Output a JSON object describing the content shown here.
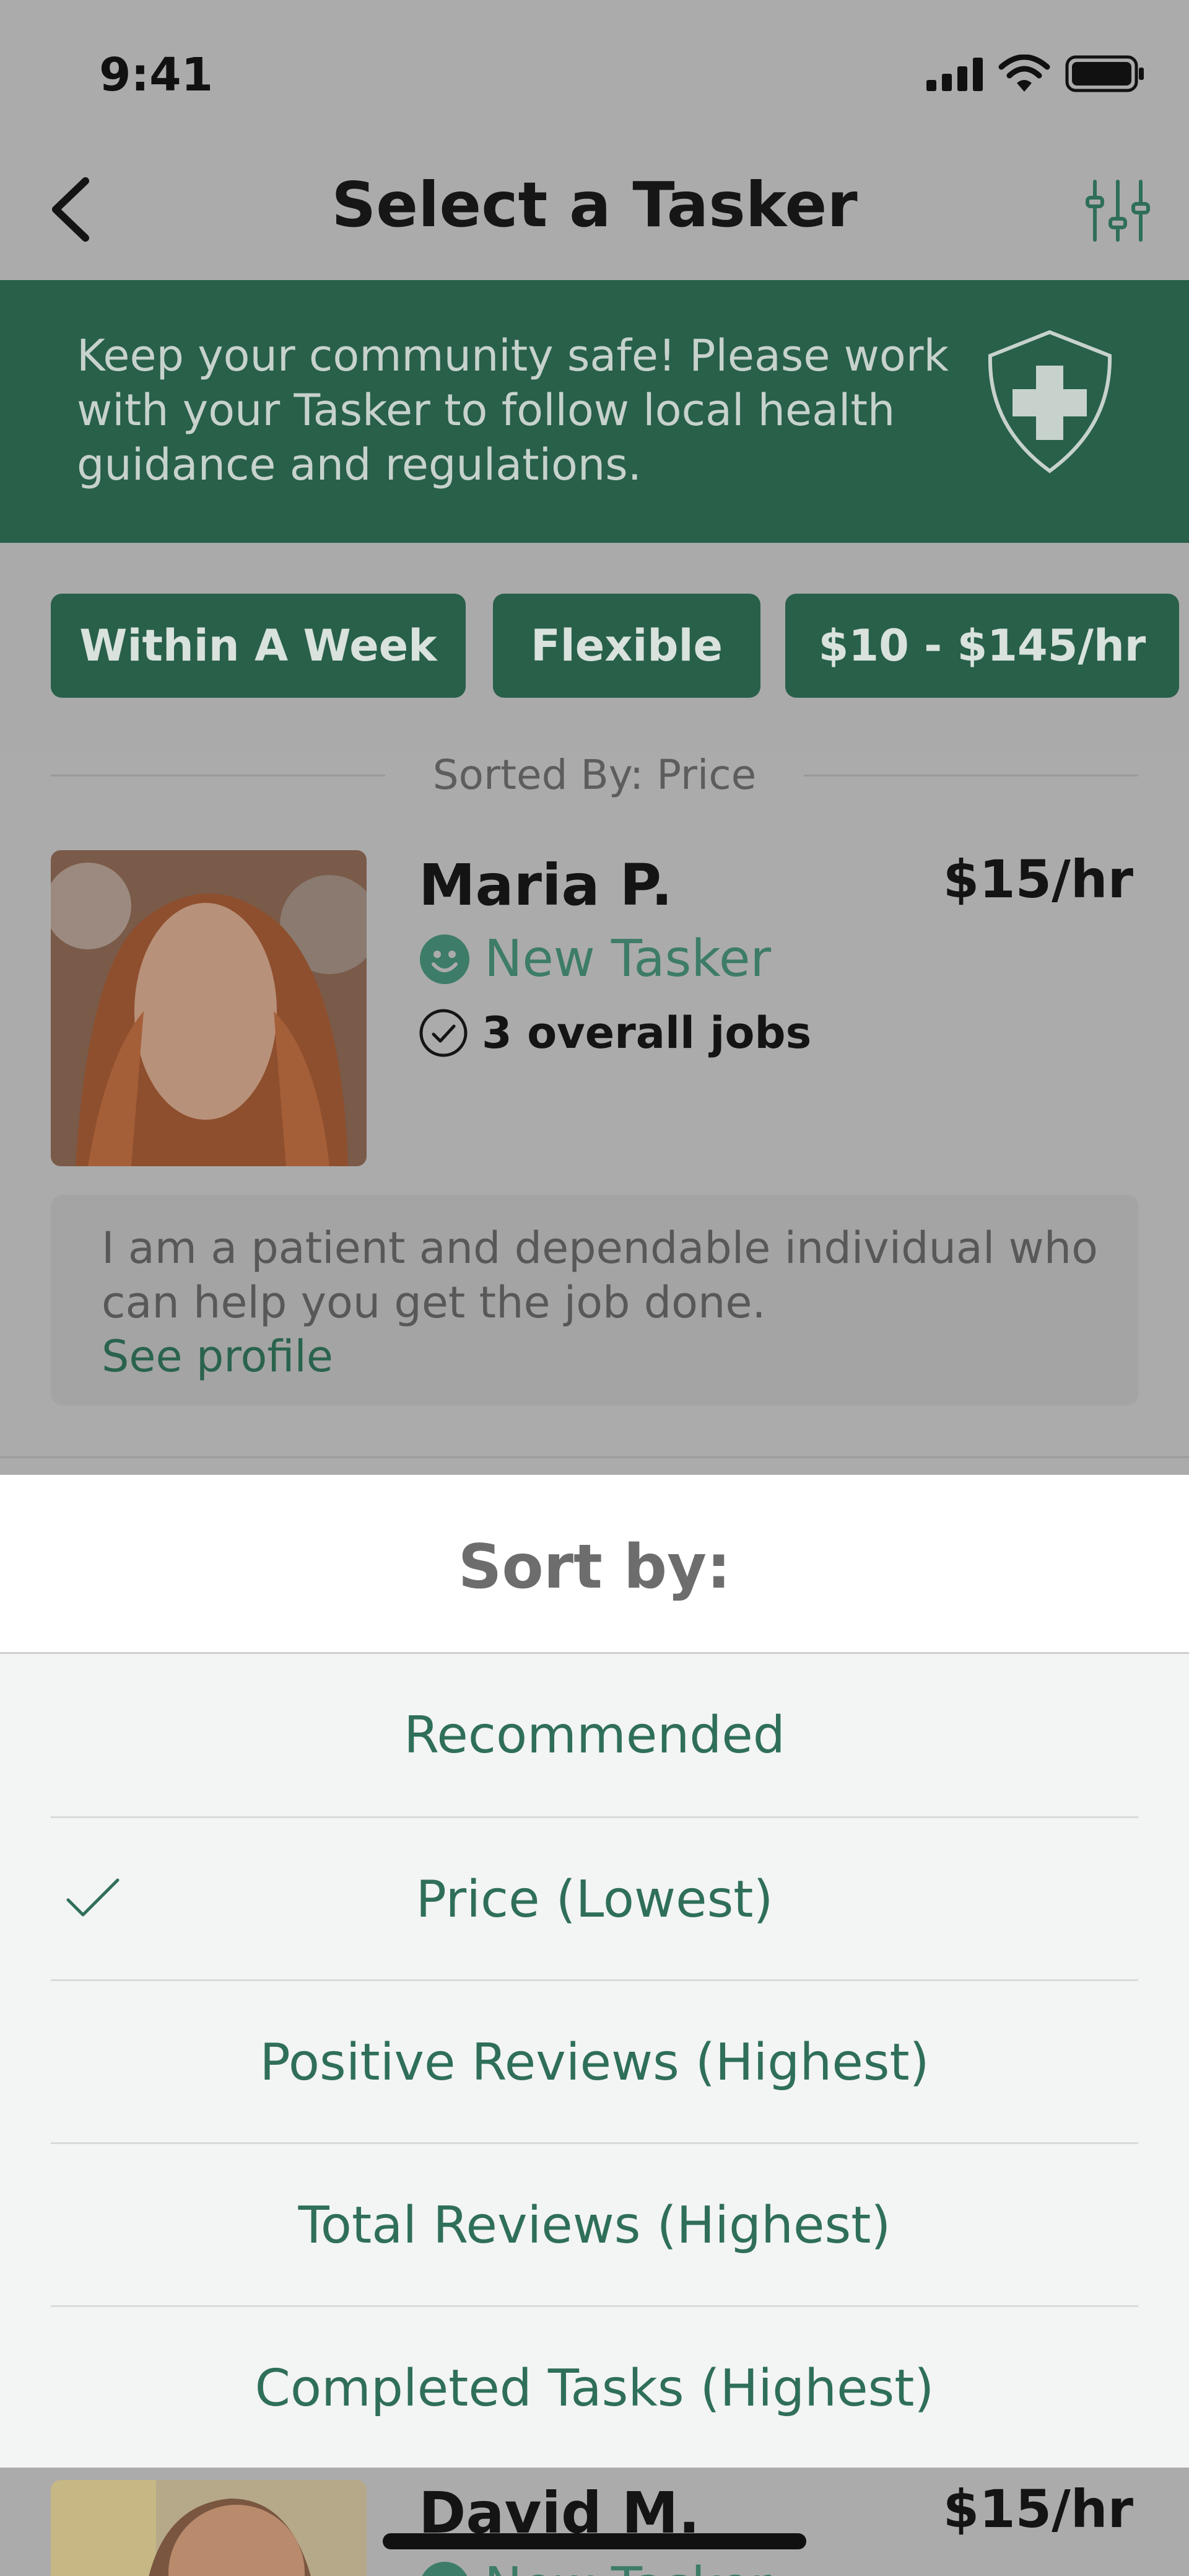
{
  "status_bar": {
    "time": "9:41"
  },
  "nav": {
    "title": "Select a Tasker"
  },
  "health_banner": {
    "text": "Keep your community safe! Please work with your Tasker to follow local health guidance and regulations."
  },
  "filters": [
    {
      "label": "Within A Week"
    },
    {
      "label": "Flexible"
    },
    {
      "label": "$10 - $145/hr"
    }
  ],
  "sorted_label": "Sorted By: Price",
  "taskers": [
    {
      "name": "Maria P.",
      "rate": "$15/hr",
      "badge": "New Tasker",
      "jobs": "3 overall jobs",
      "bio": "I am a patient and dependable individual who can help you get the job done.",
      "see_profile": "See profile"
    },
    {
      "name": "David M.",
      "rate": "$15/hr",
      "badge": "New Tasker"
    }
  ],
  "sort_sheet": {
    "title": "Sort by:",
    "options": [
      {
        "label": "Recommended",
        "selected": false
      },
      {
        "label": "Price (Lowest)",
        "selected": true
      },
      {
        "label": "Positive Reviews (Highest)",
        "selected": false
      },
      {
        "label": "Total Reviews (Highest)",
        "selected": false
      },
      {
        "label": "Completed Tasks (Highest)",
        "selected": false
      }
    ]
  },
  "colors": {
    "brand_green": "#28604a",
    "option_text": "#2f6f59",
    "overlay_gray": "#ababab"
  },
  "icons": {
    "back": "chevron-left-icon",
    "filter": "sliders-icon",
    "shield": "medical-shield-icon",
    "badge": "smiley-icon",
    "jobs": "check-circle-icon",
    "selected": "checkmark-icon"
  }
}
